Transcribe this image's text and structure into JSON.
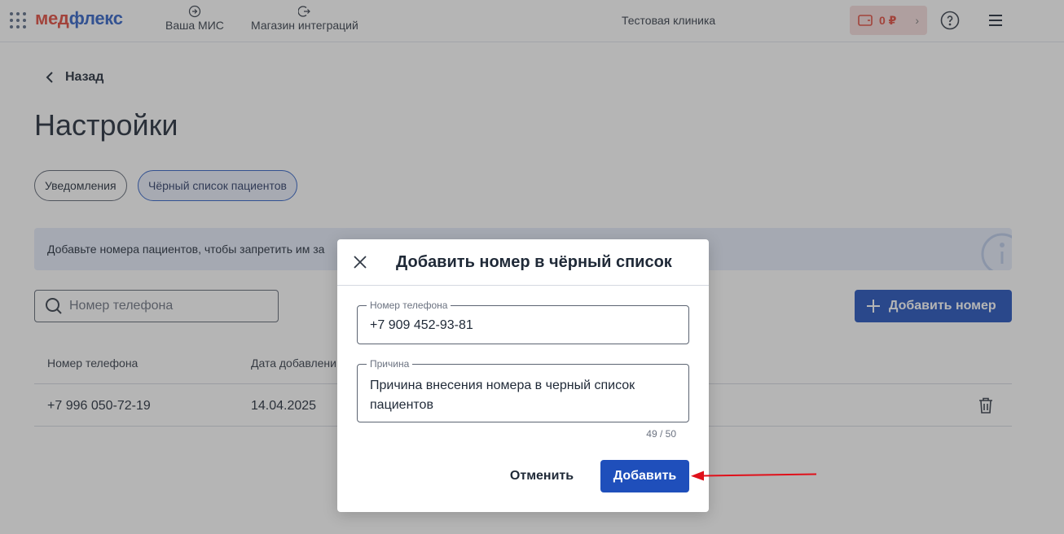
{
  "header": {
    "logo_part1": "мед",
    "logo_part2": "флекс",
    "nav": [
      {
        "label": "Ваша МИС",
        "icon": "login-icon"
      },
      {
        "label": "Магазин интеграций",
        "icon": "logout-icon"
      }
    ],
    "clinic": "Тестовая клиника",
    "balance": "0 ₽"
  },
  "page": {
    "back_label": "Назад",
    "title": "Настройки",
    "tabs": [
      {
        "label": "Уведомления",
        "active": false
      },
      {
        "label": "Чёрный список пациентов",
        "active": true
      }
    ],
    "info_text": "Добавьте номера пациентов, чтобы запретить им за",
    "search_placeholder": "Номер телефона",
    "add_button": "Добавить номер",
    "table": {
      "columns": [
        "Номер телефона",
        "Дата добавлени"
      ],
      "rows": [
        {
          "phone": "+7 996 050-72-19",
          "date": "14.04.2025"
        }
      ]
    }
  },
  "modal": {
    "title": "Добавить номер в чёрный список",
    "phone_label": "Номер телефона",
    "phone_value": "+7 909 452-93-81",
    "reason_label": "Причина",
    "reason_value": "Причина внесения номера в черный список пациентов",
    "counter": "49 / 50",
    "cancel": "Отменить",
    "submit": "Добавить"
  },
  "colors": {
    "brand_red": "#e0473a",
    "brand_blue": "#2e5fc6",
    "primary_button": "#1f4fbb",
    "annotation_arrow": "#e0101a"
  }
}
